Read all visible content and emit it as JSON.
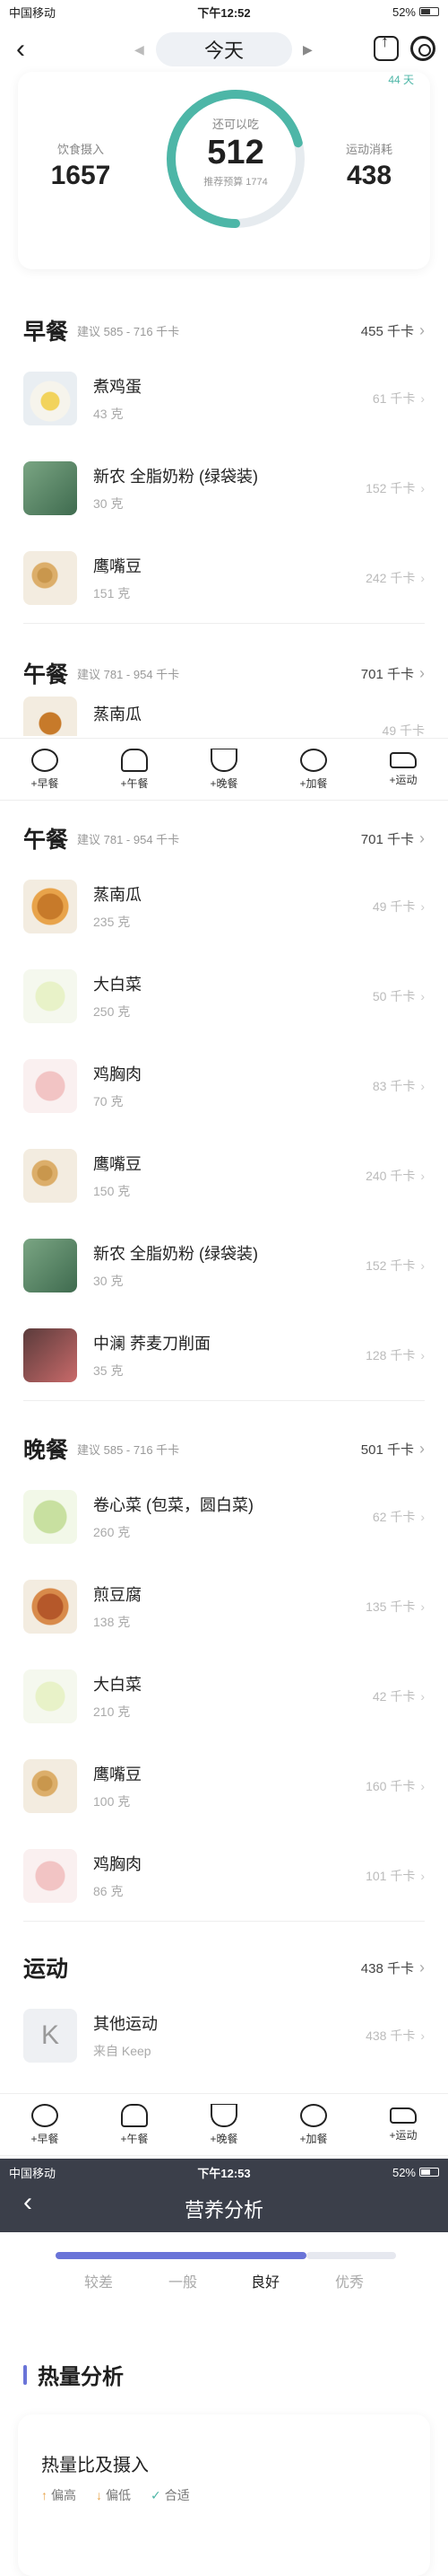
{
  "status1": {
    "carrier": "中国移动",
    "time": "下午12:52",
    "battery": "52%"
  },
  "status2": {
    "carrier": "中国移动",
    "time": "下午12:53",
    "battery": "52%"
  },
  "header": {
    "date": "今天"
  },
  "summary": {
    "intake_label": "饮食摄入",
    "intake": "1657",
    "remain_label": "还可以吃",
    "remain": "512",
    "budget": "推荐预算 1774",
    "burn_label": "运动消耗",
    "burn": "438",
    "steps": "44 天",
    "ring_progress": 0.71,
    "ring_color": "#4db6a7"
  },
  "breakfast": {
    "title": "早餐",
    "suggest": "建议 585 - 716 千卡",
    "kcal": "455 千卡",
    "items": [
      {
        "name": "煮鸡蛋",
        "gram": "43 克",
        "kcal": "61 千卡"
      },
      {
        "name": "新农 全脂奶粉 (绿袋装)",
        "gram": "30 克",
        "kcal": "152 千卡"
      },
      {
        "name": "鹰嘴豆",
        "gram": "151 克",
        "kcal": "242 千卡"
      }
    ]
  },
  "lunch_peek": {
    "title": "午餐",
    "suggest": "建议 781 - 954 千卡",
    "kcal": "701 千卡",
    "first_name": "蒸南瓜",
    "first_kcal": "49 千卡"
  },
  "tabs": [
    "+早餐",
    "+午餐",
    "+晚餐",
    "+加餐",
    "+运动"
  ],
  "lunch": {
    "title": "午餐",
    "suggest": "建议 781 - 954 千卡",
    "kcal": "701 千卡",
    "items": [
      {
        "name": "蒸南瓜",
        "gram": "235 克",
        "kcal": "49 千卡"
      },
      {
        "name": "大白菜",
        "gram": "250 克",
        "kcal": "50 千卡"
      },
      {
        "name": "鸡胸肉",
        "gram": "70 克",
        "kcal": "83 千卡"
      },
      {
        "name": "鹰嘴豆",
        "gram": "150 克",
        "kcal": "240 千卡"
      },
      {
        "name": "新农 全脂奶粉 (绿袋装)",
        "gram": "30 克",
        "kcal": "152 千卡"
      },
      {
        "name": "中澜 荞麦刀削面",
        "gram": "35 克",
        "kcal": "128 千卡"
      }
    ]
  },
  "dinner": {
    "title": "晚餐",
    "suggest": "建议 585 - 716 千卡",
    "kcal": "501 千卡",
    "items": [
      {
        "name": "卷心菜 (包菜，圆白菜)",
        "gram": "260 克",
        "kcal": "62 千卡"
      },
      {
        "name": "煎豆腐",
        "gram": "138 克",
        "kcal": "135 千卡"
      },
      {
        "name": "大白菜",
        "gram": "210 克",
        "kcal": "42 千卡"
      },
      {
        "name": "鹰嘴豆",
        "gram": "100 克",
        "kcal": "160 千卡"
      },
      {
        "name": "鸡胸肉",
        "gram": "86 克",
        "kcal": "101 千卡"
      }
    ]
  },
  "exercise": {
    "title": "运动",
    "kcal": "438 千卡",
    "items": [
      {
        "name": "其他运动",
        "source": "来自 Keep",
        "kcal": "438 千卡"
      }
    ]
  },
  "nutrition": {
    "title": "营养分析",
    "rating_labels": [
      "较差",
      "一般",
      "良好",
      "优秀"
    ],
    "rating_selected": "良好",
    "heat_title": "热量分析",
    "card_title": "热量比及摄入",
    "legend": [
      "偏高",
      "偏低",
      "合适"
    ]
  }
}
